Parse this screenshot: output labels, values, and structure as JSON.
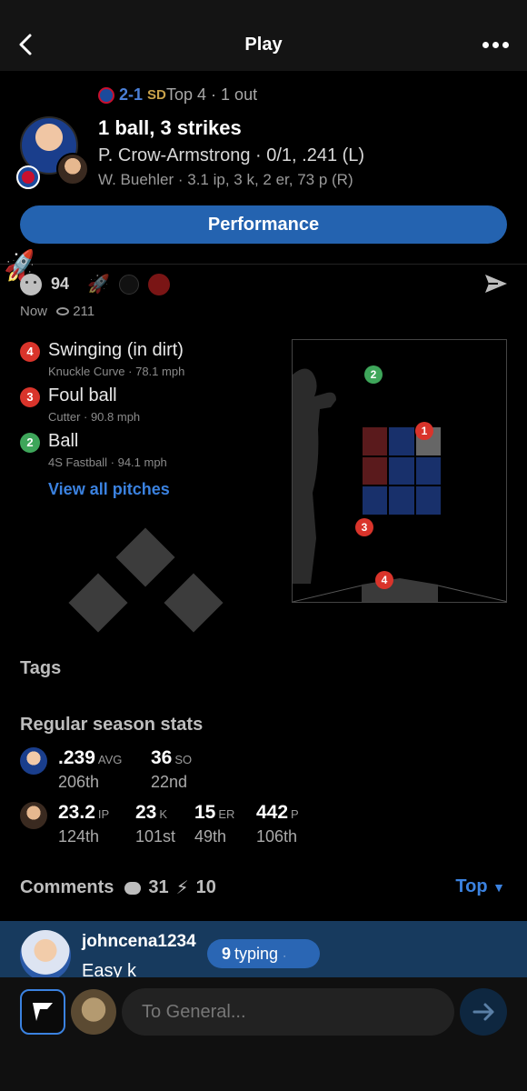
{
  "nav": {
    "title": "Play"
  },
  "game": {
    "score": "2-1",
    "inning": "Top 4 · 1 out",
    "count": "1 ball, 3 strikes",
    "batter": "P. Crow-Armstrong · 0/1, .241 (L)",
    "pitcher": "W. Buehler · 3.1 ip, 3 k, 2 er, 73 p (R)",
    "performance_label": "Performance"
  },
  "reactions": {
    "count": "94"
  },
  "meta": {
    "time": "Now",
    "views": "211"
  },
  "pitches": [
    {
      "num": "4",
      "result": "Swinging (in dirt)",
      "detail": "Knuckle Curve · 78.1 mph",
      "color": "#d9342b"
    },
    {
      "num": "3",
      "result": "Foul ball",
      "detail": "Cutter · 90.8 mph",
      "color": "#d9342b"
    },
    {
      "num": "2",
      "result": "Ball",
      "detail": "4S Fastball · 94.1 mph",
      "color": "#3ea65a"
    }
  ],
  "view_all_label": "View all pitches",
  "zone_dots": [
    "1",
    "2",
    "3",
    "4"
  ],
  "sections": {
    "tags": "Tags",
    "stats": "Regular season stats"
  },
  "batter_stats": [
    {
      "value": ".239",
      "unit": "AVG",
      "rank": "206th"
    },
    {
      "value": "36",
      "unit": "SO",
      "rank": "22nd"
    }
  ],
  "pitcher_stats": [
    {
      "value": "23.2",
      "unit": "IP",
      "rank": "124th"
    },
    {
      "value": "23",
      "unit": "K",
      "rank": "101st"
    },
    {
      "value": "15",
      "unit": "ER",
      "rank": "49th"
    },
    {
      "value": "442",
      "unit": "P",
      "rank": "106th"
    }
  ],
  "comments": {
    "title": "Comments",
    "count": "31",
    "bolts": "10",
    "sort": "Top"
  },
  "latest_comment": {
    "user": "johncena1234",
    "text": "Easy k"
  },
  "typing": {
    "count": "9",
    "label": "typing"
  },
  "composer": {
    "placeholder": "To General..."
  },
  "colors": {
    "accent": "#2463b0",
    "link": "#3b82e0",
    "strike": "#d9342b",
    "ball": "#3ea65a"
  }
}
